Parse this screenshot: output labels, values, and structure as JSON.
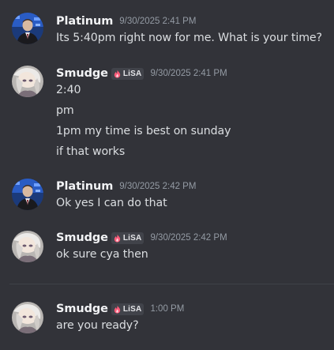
{
  "messages": [
    {
      "username": "Platinum",
      "avatar": "platinum-avatar",
      "timestamp": "9/30/2025 2:41 PM",
      "lines": [
        "Its 5:40pm right now for me. What is your time?"
      ]
    },
    {
      "username": "Smudge",
      "avatar": "smudge-avatar",
      "tag": "LiSA",
      "timestamp": "9/30/2025 2:41 PM",
      "lines": [
        "2:40",
        "pm",
        "1pm my time is best on sunday",
        "if that works"
      ]
    },
    {
      "username": "Platinum",
      "avatar": "platinum-avatar",
      "timestamp": "9/30/2025 2:42 PM",
      "lines": [
        "Ok yes I can do that"
      ]
    },
    {
      "username": "Smudge",
      "avatar": "smudge-avatar",
      "tag": "LiSA",
      "timestamp": "9/30/2025 2:42 PM",
      "lines": [
        "ok sure cya then"
      ]
    },
    {
      "username": "Smudge",
      "avatar": "smudge-avatar",
      "tag": "LiSA",
      "timestamp": "1:00 PM",
      "lines": [
        "are you ready?"
      ]
    }
  ],
  "colors": {
    "background": "#323339",
    "username": "#f2f3f5",
    "text": "#dbdee1",
    "timestamp": "#949ba4",
    "tag_background": "#41434a",
    "tag_icon": "#ff5c7a"
  }
}
